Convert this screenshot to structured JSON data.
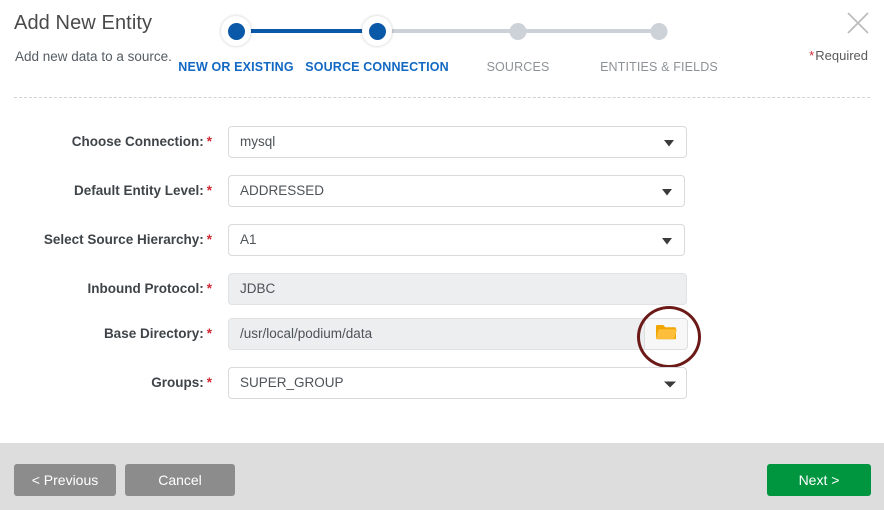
{
  "dialog": {
    "title": "Add New Entity",
    "subtitle": "Add new data to a source.",
    "close_icon": "close-icon",
    "required_star": "*",
    "required_label": "Required"
  },
  "stepper": {
    "steps": [
      {
        "label": "NEW OR EXISTING",
        "state": "active"
      },
      {
        "label": "SOURCE CONNECTION",
        "state": "active"
      },
      {
        "label": "SOURCES",
        "state": "inactive"
      },
      {
        "label": "ENTITIES & FIELDS",
        "state": "inactive"
      }
    ],
    "active_color": "#0a58a8",
    "inactive_color": "#ccd2d8",
    "active_label_color": "#1268c3",
    "inactive_label_color": "#8d9297"
  },
  "form": {
    "required_marker": "*",
    "fields": [
      {
        "label": "Choose Connection:",
        "value": "mysql",
        "type": "select",
        "required": true,
        "readonly": false
      },
      {
        "label": "Default Entity Level:",
        "value": "ADDRESSED",
        "type": "select",
        "required": true,
        "readonly": false
      },
      {
        "label": "Select Source Hierarchy:",
        "value": "A1",
        "type": "select",
        "required": true,
        "readonly": false
      },
      {
        "label": "Inbound Protocol:",
        "value": "JDBC",
        "type": "text",
        "required": true,
        "readonly": true
      },
      {
        "label": "Base Directory:",
        "value": "/usr/local/podium/data",
        "type": "text-with-browse",
        "required": true,
        "readonly": true,
        "browse_icon": "folder-icon"
      },
      {
        "label": "Groups:",
        "value": "SUPER_GROUP",
        "type": "select",
        "required": true,
        "readonly": false
      }
    ]
  },
  "annotation": {
    "shape": "ellipse",
    "color": "#6b1a18",
    "target": "browse-folder-button"
  },
  "footer": {
    "previous_label": "< Previous",
    "cancel_label": "Cancel",
    "next_label": "Next >",
    "next_color": "#009640",
    "secondary_color": "#8c8c8c"
  }
}
